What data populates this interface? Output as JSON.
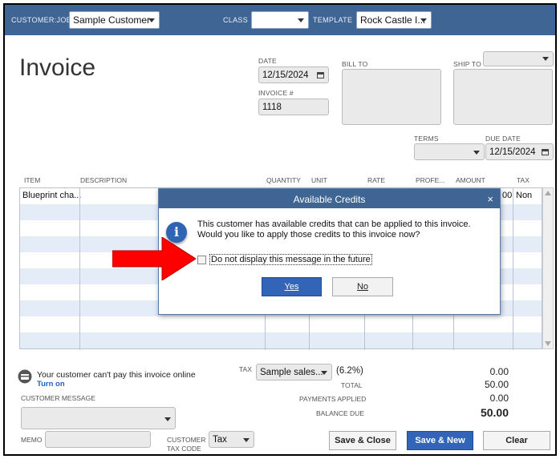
{
  "header": {
    "customer_job_label": "CUSTOMER:JOB",
    "customer_job_value": "Sample Customer",
    "class_label": "CLASS",
    "class_value": "",
    "template_label": "TEMPLATE",
    "template_value": "Rock Castle I..."
  },
  "form": {
    "title": "Invoice",
    "date_label": "DATE",
    "date_value": "12/15/2024",
    "invoice_no_label": "INVOICE #",
    "invoice_no_value": "1118",
    "bill_to_label": "BILL TO",
    "ship_to_label": "SHIP TO",
    "terms_label": "TERMS",
    "terms_value": "",
    "due_date_label": "DUE DATE",
    "due_date_value": "12/15/2024"
  },
  "grid": {
    "columns": [
      "ITEM",
      "DESCRIPTION",
      "QUANTITY",
      "UNIT",
      "RATE",
      "PROFE...",
      "AMOUNT",
      "TAX"
    ],
    "first_row": {
      "item": "Blueprint cha...",
      "amount_fragment": "00",
      "tax": "Non"
    }
  },
  "dialog": {
    "title": "Available Credits",
    "close_glyph": "×",
    "icon": "info-icon",
    "message": "This customer has available credits that can be applied to this invoice. Would you like to apply those credits to this invoice now?",
    "checkbox_label": "Do not display this message in the future",
    "yes_label": "Yes",
    "no_label": "No"
  },
  "footer": {
    "online_payment_text": "Your customer can't pay this invoice online",
    "turn_on_label": "Turn on",
    "customer_message_label": "CUSTOMER MESSAGE",
    "memo_label": "MEMO",
    "customer_tax_code_label_1": "CUSTOMER",
    "customer_tax_code_label_2": "TAX CODE",
    "customer_tax_code_value": "Tax",
    "tax_label": "TAX",
    "tax_item_value": "Sample sales...",
    "tax_rate": "(6.2%)",
    "tax_amount": "0.00",
    "total_label": "TOTAL",
    "total_value": "50.00",
    "payments_applied_label": "PAYMENTS APPLIED",
    "payments_applied_value": "0.00",
    "balance_due_label": "BALANCE DUE",
    "balance_due_value": "50.00",
    "save_close_label": "Save & Close",
    "save_new_label": "Save & New",
    "clear_label": "Clear"
  },
  "colors": {
    "header_bar": "#3f6594",
    "primary_button": "#3264b8",
    "row_alt": "#e4ecf8",
    "annotation_arrow": "#ff0000"
  }
}
